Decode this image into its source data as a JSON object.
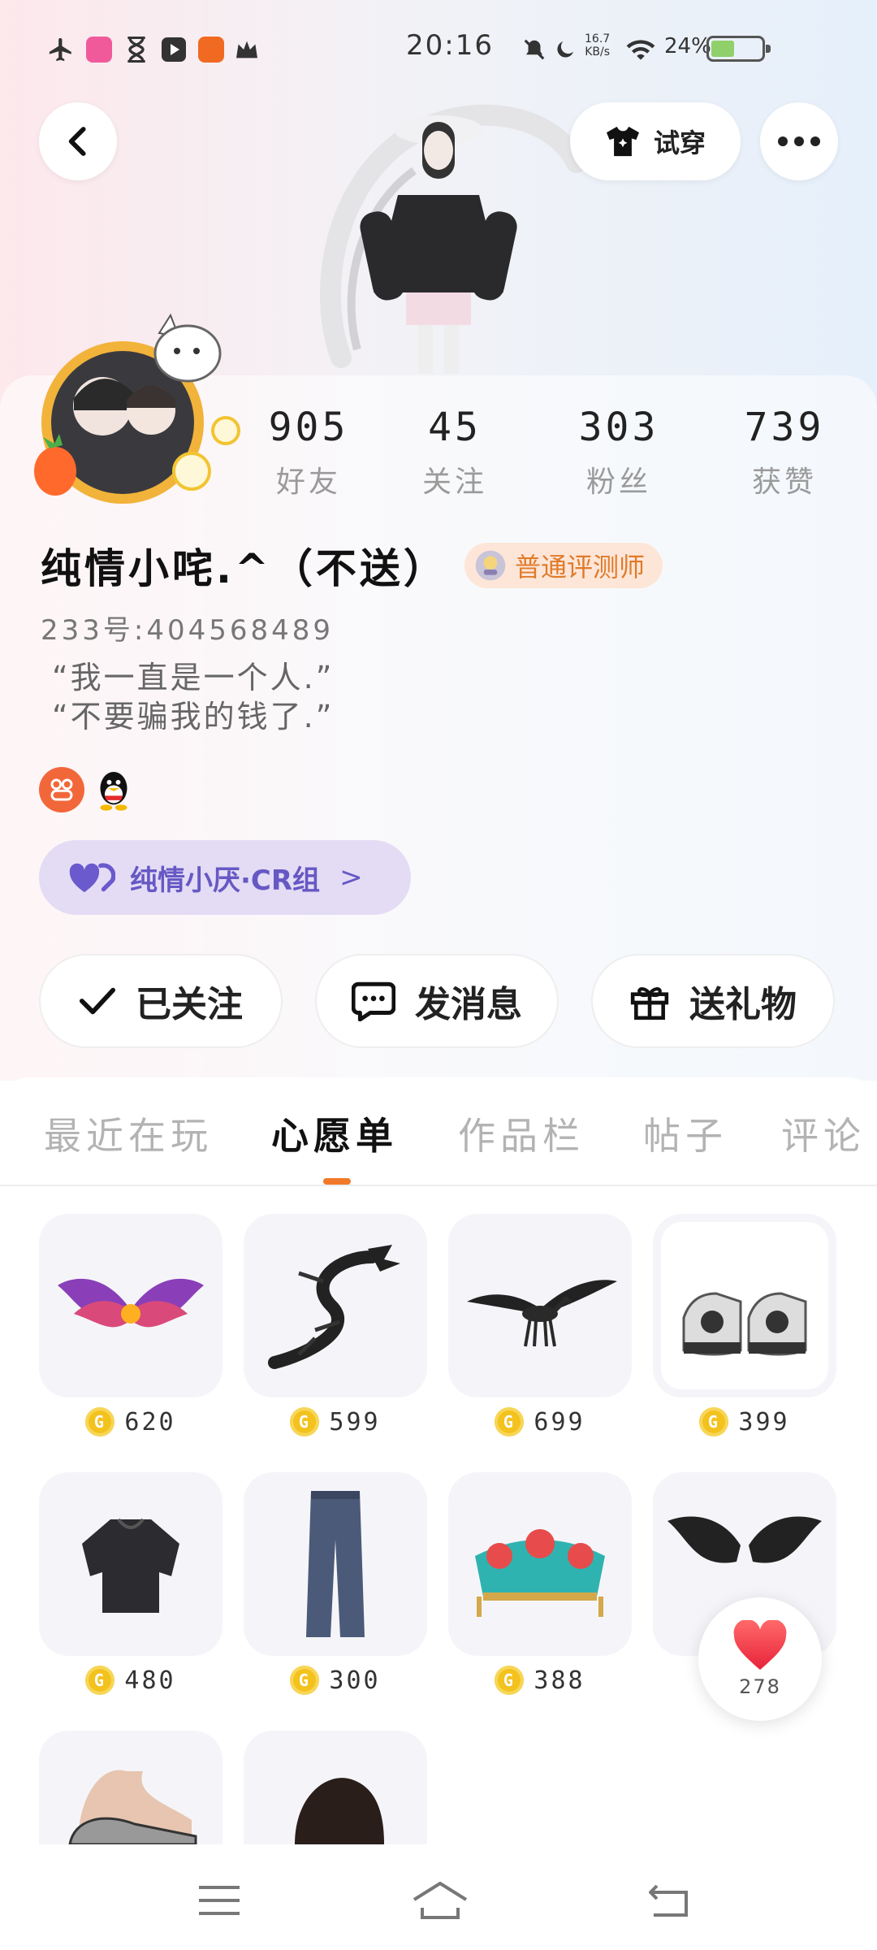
{
  "status_bar": {
    "time": "20:16",
    "net_speed": "16.7",
    "net_unit": "KB/s",
    "battery_pct": "24%",
    "battery_level": 0.24,
    "left_icons": [
      "airplane-icon",
      "app-icon-pink",
      "hourglass-icon",
      "video-icon",
      "app-icon-orange",
      "crown-icon"
    ],
    "right_icons": [
      "mute-icon",
      "moon-icon",
      "wifi-icon",
      "battery-icon"
    ]
  },
  "header": {
    "back_icon": "chevron-left-icon",
    "try_on_label": "试穿",
    "more_icon": "more-dots-icon"
  },
  "stats": [
    {
      "value": "905",
      "label": "好友"
    },
    {
      "value": "45",
      "label": "关注"
    },
    {
      "value": "303",
      "label": "粉丝"
    },
    {
      "value": "739",
      "label": "获赞"
    }
  ],
  "profile": {
    "name": "纯情小咤.^（不送）",
    "badge_label": "普通评测师",
    "id_text": "233号:404568489",
    "signature_line1": "“我一直是一个人.”",
    "signature_line2": "“不要骗我的钱了.”",
    "group_label": "纯情小厌·CR组",
    "group_arrow": ">"
  },
  "actions": {
    "followed_label": "已关注",
    "message_label": "发消息",
    "gift_label": "送礼物"
  },
  "tabs": [
    "最近在玩",
    "心愿单",
    "作品栏",
    "帖子",
    "评论"
  ],
  "active_tab": "心愿单",
  "wishlist": [
    {
      "item": "wings-purple",
      "price": "620"
    },
    {
      "item": "dragon-black",
      "price": "599"
    },
    {
      "item": "pegasus-black",
      "price": "699"
    },
    {
      "item": "sneakers",
      "price": "399"
    },
    {
      "item": "hoodie-black",
      "price": "480"
    },
    {
      "item": "jeans",
      "price": "300"
    },
    {
      "item": "headdress",
      "price": "388"
    },
    {
      "item": "wings-black",
      "price": ""
    },
    {
      "item": "shoes-lace",
      "price": ""
    },
    {
      "item": "hair-black",
      "price": ""
    }
  ],
  "coin_symbol": "G",
  "like": {
    "count": "278"
  },
  "colors": {
    "accent": "#f07a2a",
    "group_bg": "#e4dcf4",
    "group_text": "#6658c4",
    "badge_bg": "#fde6d8",
    "badge_text": "#e07b2a",
    "coin": "#f3c21d"
  }
}
